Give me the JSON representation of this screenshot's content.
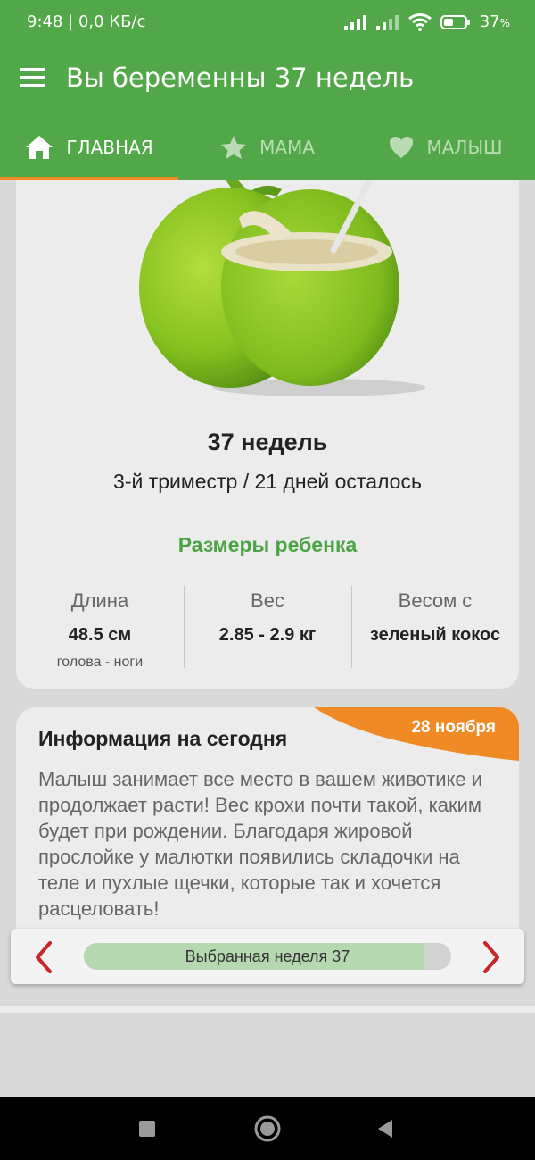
{
  "status": {
    "time": "9:48",
    "net_speed": "0,0 КБ/с",
    "battery": "37",
    "battery_unit": "%"
  },
  "app": {
    "title": "Вы беременны 37 недель"
  },
  "tabs": [
    {
      "label": "ГЛАВНАЯ",
      "icon": "home-icon"
    },
    {
      "label": "МАМА",
      "icon": "star-icon"
    },
    {
      "label": "МАЛЫШ",
      "icon": "heart-icon"
    }
  ],
  "week_card": {
    "weeks": "37 недель",
    "trimester": "3-й триместр / 21 дней осталось",
    "sizes_title": "Размеры ребенка",
    "metrics": [
      {
        "label": "Длина",
        "value": "48.5 см",
        "sub": "голова - ноги"
      },
      {
        "label": "Вес",
        "value": "2.85 - 2.9 кг",
        "sub": ""
      },
      {
        "label": "Весом с",
        "value": "зеленый кокос",
        "sub": ""
      }
    ]
  },
  "info": {
    "title": "Информация на сегодня",
    "date": "28 ноября",
    "text": "Малыш занимает все место в вашем животике и продолжает расти! Вес крохи почти такой, каким будет при рождении. Благодаря жировой прослойке у малютки появились складочки на теле и пухлые щечки, которые так и хочется расцеловать!"
  },
  "week_selector": {
    "label": "Выбранная неделя 37",
    "progress": 0.925
  },
  "colors": {
    "brand": "#52a748",
    "accent": "#f08a24",
    "arrow": "#c62828",
    "title_green": "#4ba443"
  }
}
